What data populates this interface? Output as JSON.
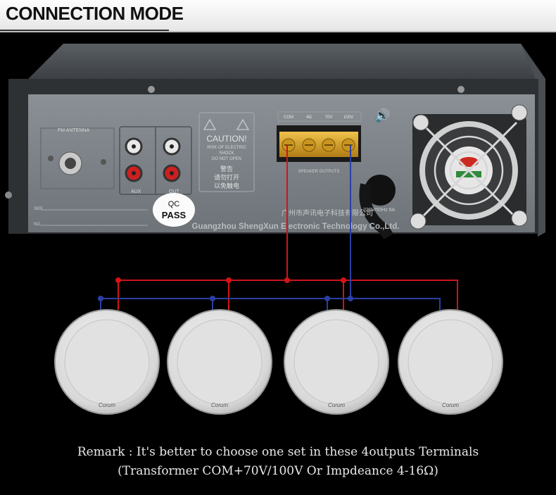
{
  "header": {
    "title": "CONNECTION MODE"
  },
  "panel": {
    "fm_antenna": "FM ANTENNA",
    "aux": "AUX",
    "out": "OUT",
    "ser": "SER.",
    "no": "NO.",
    "caution_title": "CAUTION!",
    "caution_line1": "RISK OF ELECTRIC",
    "caution_line2": "SHOCK",
    "caution_line3": "DO NOT OPEN",
    "caution_cn1": "警告",
    "caution_cn2": "请勿打开",
    "caution_cn3": "以免触电",
    "qc_line1": "QC",
    "qc_line2": "PASS",
    "terminals": [
      "COM",
      "4Ω",
      "70V",
      "100V"
    ],
    "speaker_outputs": "SPEAKER OUTPUTS",
    "power": "~220V/50Hz  6A",
    "company_cn": "广州市声讯电子科技有限公司",
    "company_en": "Guangzhou ShengXun Electronic Technology Co.,Ltd."
  },
  "speakers": {
    "count": 4,
    "brand": "Corum"
  },
  "wire_colors": {
    "red": "#d0141a",
    "blue": "#2b3fa3"
  },
  "remark": {
    "line1": "Remark : It's better to choose one set in these 4outputs Terminals",
    "line2": "(Transformer COM+70V/100V Or Impdeance 4-16Ω)"
  }
}
